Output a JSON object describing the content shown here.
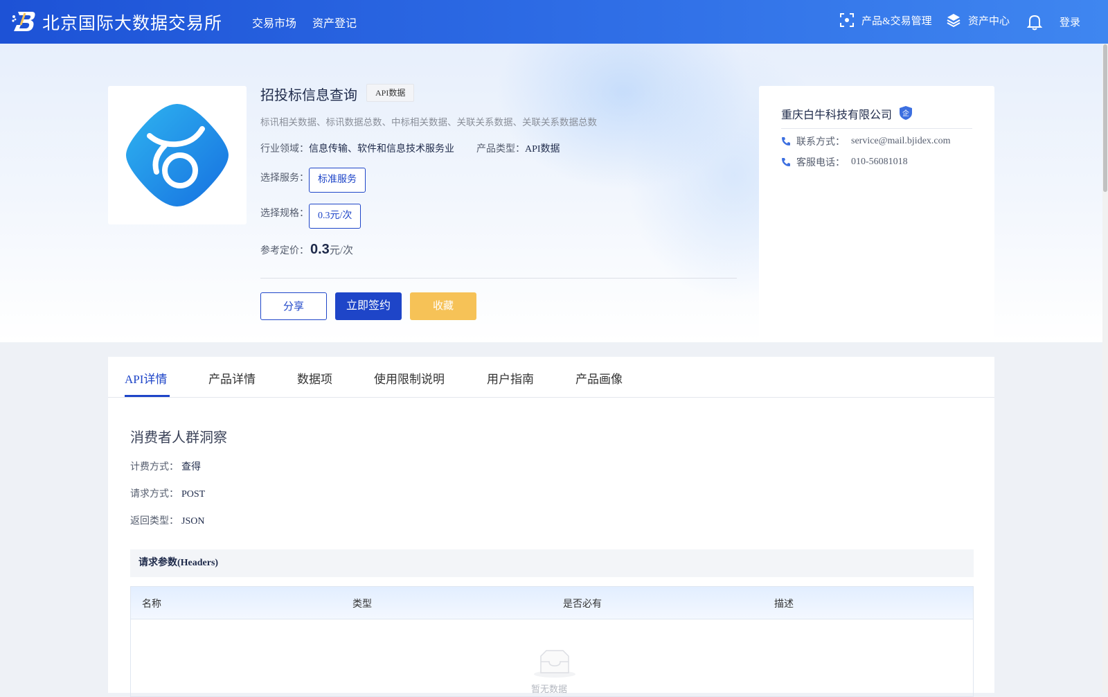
{
  "header": {
    "logo_text": "北京国际大数据交易所",
    "nav": [
      "交易市场",
      "资产登记"
    ],
    "product_mgmt": "产品&交易管理",
    "asset_center": "资产中心",
    "login": "登录"
  },
  "product": {
    "title": "招投标信息查询",
    "tag": "API数据",
    "description": "标讯相关数据、标讯数据总数、中标相关数据、关联关系数据、关联关系数据总数",
    "industry_label": "行业领域：",
    "industry_value": "信息传输、软件和信息技术服务业",
    "type_label": "产品类型：",
    "type_value": "API数据",
    "service_label": "选择服务：",
    "service_value": "标准服务",
    "spec_label": "选择规格：",
    "spec_value": "0.3元/次",
    "price_label": "参考定价：",
    "price_number": "0.3",
    "price_unit": "元/次",
    "share_button": "分享",
    "sign_button": "立即签约",
    "favorite_button": "收藏"
  },
  "company": {
    "name": "重庆白牛科技有限公司",
    "badge": "企",
    "contact_label": "联系方式：",
    "contact_value": "service@mail.bjidex.com",
    "phone_label": "客服电话：",
    "phone_value": "010-56081018"
  },
  "tabs": [
    "API详情",
    "产品详情",
    "数据项",
    "使用限制说明",
    "用户指南",
    "产品画像"
  ],
  "api": {
    "title": "消费者人群洞察",
    "billing_label": "计费方式：",
    "billing_value": "查得",
    "method_label": "请求方式：",
    "method_value": "POST",
    "return_label": "返回类型：",
    "return_value": "JSON",
    "headers_section": "请求参数(Headers)",
    "columns": [
      "名称",
      "类型",
      "是否必有",
      "描述"
    ],
    "empty_text": "暂无数据"
  },
  "colors": {
    "primary": "#1e45c8",
    "header_gradient_start": "#1d52d6",
    "favorite": "#f6c257"
  }
}
